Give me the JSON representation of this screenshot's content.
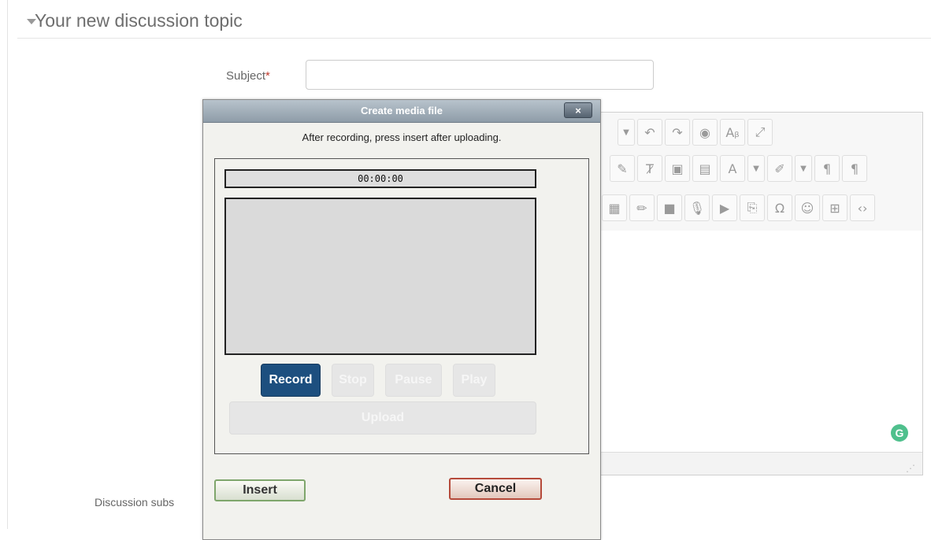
{
  "section": {
    "title": "Your new discussion topic"
  },
  "form": {
    "subject_label": "Subject",
    "subject_required_mark": "*",
    "subject_value": "",
    "discussion_subscription_label": "Discussion subs"
  },
  "editor": {
    "toolbar_row1": [
      "chevron-down-icon",
      "undo-icon",
      "redo-icon",
      "find-icon",
      "replace-icon",
      "fullscreen-icon"
    ],
    "toolbar_row2": [
      "brush-icon",
      "clear-format-icon",
      "paste-text-icon",
      "paste-word-icon",
      "font-color-icon",
      "background-color-icon",
      "ltr-icon",
      "rtl-icon"
    ],
    "toolbar_row3": [
      "image-icon",
      "draw-icon",
      "video-icon",
      "microphone-icon",
      "media-icon",
      "managefiles-icon",
      "special-char-icon",
      "emoticon-icon",
      "table-icon",
      "code-icon"
    ],
    "grammarly_badge": "G"
  },
  "dialog": {
    "title": "Create media file",
    "close_label": "×",
    "hint": "After recording, press insert after uploading.",
    "timer": "00:00:00",
    "buttons": {
      "record": "Record",
      "stop": "Stop",
      "pause": "Pause",
      "play": "Play",
      "upload": "Upload",
      "insert": "Insert",
      "cancel": "Cancel"
    }
  }
}
